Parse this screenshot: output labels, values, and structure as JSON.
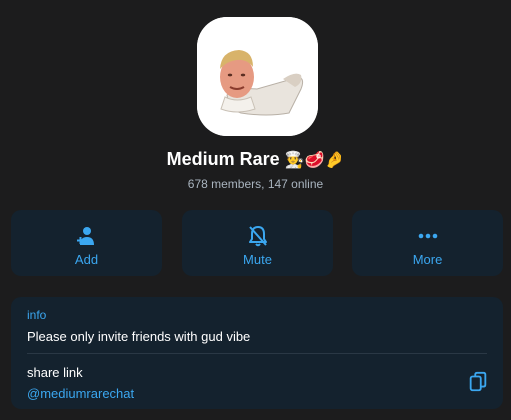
{
  "profile": {
    "name": "Medium Rare",
    "emojis": "👨‍🍳🥩🤌",
    "subtitle": "678 members, 147 online",
    "avatar_icon": "chef-portrait-sticker"
  },
  "actions": [
    {
      "label": "Add",
      "icon": "add-user-icon"
    },
    {
      "label": "Mute",
      "icon": "bell-slash-icon"
    },
    {
      "label": "More",
      "icon": "ellipsis-icon"
    }
  ],
  "info": {
    "label": "info",
    "description": "Please only invite friends with gud vibe",
    "share_label": "share link",
    "share_link": "@mediumrarechat",
    "copy_icon": "copy-icon"
  },
  "colors": {
    "background": "#1c1c1d",
    "card": "#14222e",
    "accent": "#3ba7f0",
    "text": "#ffffff",
    "muted": "#a9b4bf"
  }
}
